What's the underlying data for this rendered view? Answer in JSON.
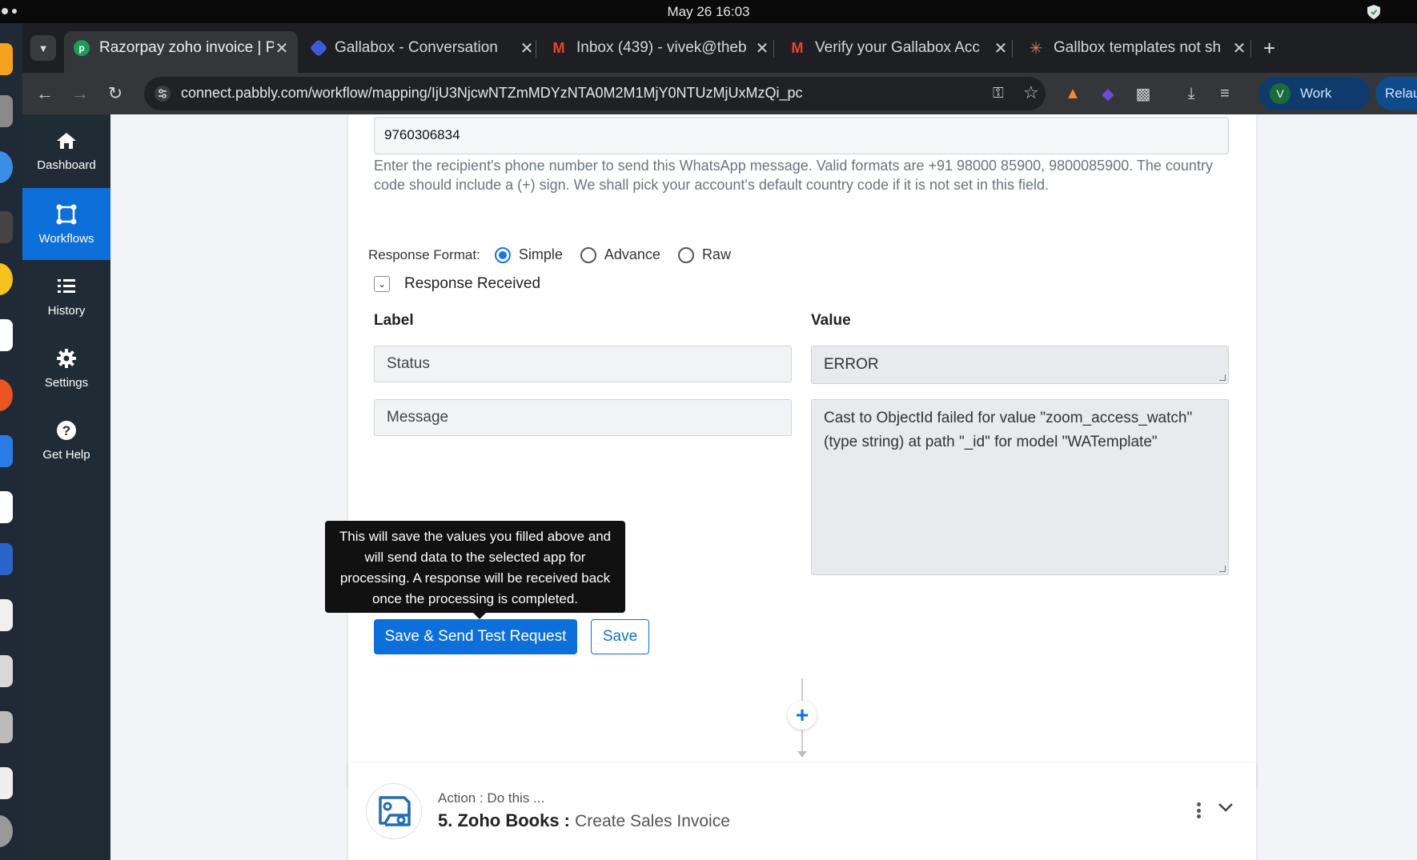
{
  "os": {
    "clock": "May 26  16:03"
  },
  "browser": {
    "tabs": [
      {
        "title": "Razorpay zoho invoice | P",
        "active": true
      },
      {
        "title": "Gallabox - Conversation",
        "active": false
      },
      {
        "title": "Inbox (439) - vivek@theb",
        "active": false
      },
      {
        "title": "Verify your Gallabox Acc",
        "active": false
      },
      {
        "title": "Gallbox templates not sh",
        "active": false
      }
    ],
    "url": "connect.pabbly.com/workflow/mapping/IjU3NjcwNTZmMDYzNTA0M2M1MjY0NTUzMjUxMzQi_pc",
    "profile": {
      "initial": "V",
      "label": "Work"
    },
    "relaunch_label": "Relaunch t"
  },
  "sidebar": {
    "items": [
      {
        "label": "Dashboard",
        "icon": "home-icon"
      },
      {
        "label": "Workflows",
        "icon": "workflow-icon",
        "active": true
      },
      {
        "label": "History",
        "icon": "history-icon"
      },
      {
        "label": "Settings",
        "icon": "gear-icon"
      },
      {
        "label": "Get Help",
        "icon": "question-icon"
      }
    ]
  },
  "form": {
    "phone_value": "9760306834",
    "phone_help": "Enter the recipient's phone number to send this WhatsApp message. Valid formats are +91 98000 85900, 9800085900. The country code should include a (+) sign. We shall pick your account's default country code if it is not set in this field.",
    "response_format_label": "Response Format:",
    "response_format_options": [
      "Simple",
      "Advance",
      "Raw"
    ],
    "response_format_selected": "Simple",
    "response_received_label": "Response Received",
    "label_header": "Label",
    "value_header": "Value",
    "rows": [
      {
        "label": "Status",
        "value": "ERROR"
      },
      {
        "label": "Message",
        "value": "Cast to ObjectId failed for value \"zoom_access_watch\" (type string) at path \"_id\" for model \"WATemplate\""
      }
    ],
    "tooltip": "This will save the values you filled above and will send data to the selected app for processing. A response will be received back once the processing is completed.",
    "save_send_label": "Save & Send Test Request",
    "save_label": "Save"
  },
  "next_action": {
    "subtitle": "Action : Do this ...",
    "step_app": "5. Zoho Books :",
    "event": "Create Sales Invoice"
  }
}
